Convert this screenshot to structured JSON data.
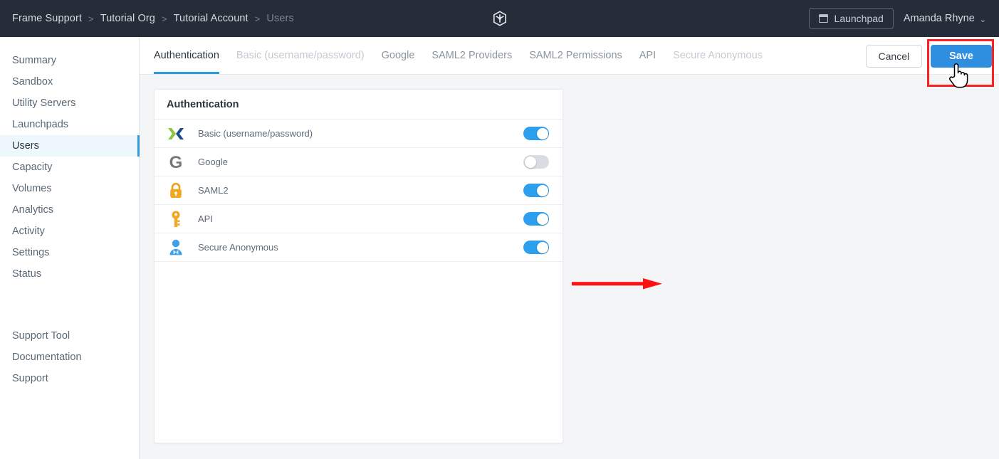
{
  "header": {
    "breadcrumb": [
      {
        "label": "Frame Support",
        "muted": false
      },
      {
        "label": "Tutorial Org",
        "muted": false
      },
      {
        "label": "Tutorial Account",
        "muted": false
      },
      {
        "label": "Users",
        "muted": true
      }
    ],
    "separator": ">",
    "logo_icon": "cube-logo-icon",
    "launchpad_label": "Launchpad",
    "launchpad_icon": "window-icon",
    "user_name": "Amanda Rhyne",
    "user_chevron": "⌄",
    "bar_color": "#262d38"
  },
  "sidebar": {
    "items": [
      {
        "label": "Summary",
        "active": false
      },
      {
        "label": "Sandbox",
        "active": false
      },
      {
        "label": "Utility Servers",
        "active": false
      },
      {
        "label": "Launchpads",
        "active": false
      },
      {
        "label": "Users",
        "active": true
      },
      {
        "label": "Capacity",
        "active": false
      },
      {
        "label": "Volumes",
        "active": false
      },
      {
        "label": "Analytics",
        "active": false
      },
      {
        "label": "Activity",
        "active": false
      },
      {
        "label": "Settings",
        "active": false
      },
      {
        "label": "Status",
        "active": false
      }
    ],
    "footer_items": [
      {
        "label": "Support Tool"
      },
      {
        "label": "Documentation"
      },
      {
        "label": "Support"
      }
    ],
    "active_accent": "#2e9bd6",
    "active_background": "#eef7fc"
  },
  "tabs": [
    {
      "label": "Authentication",
      "state": "active"
    },
    {
      "label": "Basic (username/password)",
      "state": "disabled"
    },
    {
      "label": "Google",
      "state": "normal"
    },
    {
      "label": "SAML2 Providers",
      "state": "normal"
    },
    {
      "label": "SAML2 Permissions",
      "state": "normal"
    },
    {
      "label": "API",
      "state": "normal"
    },
    {
      "label": "Secure Anonymous",
      "state": "disabled"
    }
  ],
  "actions": {
    "cancel_label": "Cancel",
    "save_label": "Save",
    "save_color": "#2e8fe0",
    "highlight_color": "#fd2020",
    "cursor_icon": "pointing-hand-cursor"
  },
  "card": {
    "title": "Authentication",
    "rows": [
      {
        "label": "Basic (username/password)",
        "icon": "frame-x-icon",
        "enabled": true
      },
      {
        "label": "Google",
        "icon": "google-g-icon",
        "enabled": false
      },
      {
        "label": "SAML2",
        "icon": "lock-icon",
        "enabled": true
      },
      {
        "label": "API",
        "icon": "key-icon",
        "enabled": true
      },
      {
        "label": "Secure Anonymous",
        "icon": "user-person-icon",
        "enabled": true
      }
    ],
    "toggle_on_color": "#2ca0ef",
    "toggle_off_color": "#d9dde1"
  },
  "annotation": {
    "arrow_icon": "red-arrow-right-icon",
    "arrow_color": "#fd1111",
    "points_at": "Secure Anonymous"
  }
}
